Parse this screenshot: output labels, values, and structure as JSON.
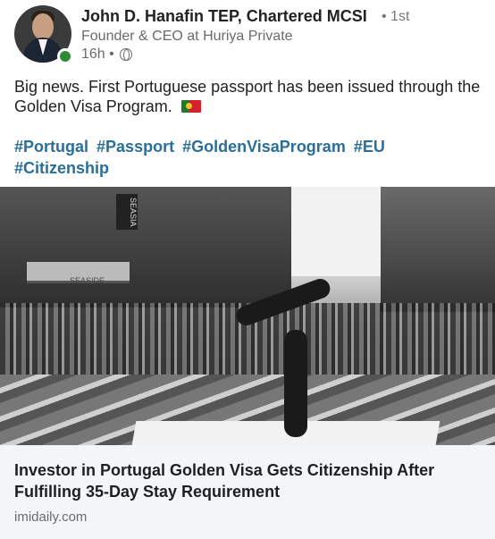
{
  "post": {
    "author": {
      "name": "John D. Hanafin TEP, Chartered MCSI",
      "connection_degree": "• 1st",
      "headline": "Founder & CEO at Huriya Private"
    },
    "time_ago": "16h •",
    "visibility_icon": "globe-icon",
    "text": "Big news. First Portuguese passport has been issued through the Golden Visa Program.",
    "flag_icon": "portugal-flag-icon",
    "hashtags": [
      "#Portugal",
      "#Passport",
      "#GoldenVisaProgram",
      "#EU",
      "#Citizenship"
    ]
  },
  "image": {
    "street_sign_text": "SEASIA",
    "shop_sign_text": "SEASIDE"
  },
  "link_preview": {
    "title": "Investor in Portugal Golden Visa Gets Citizenship After Fulfilling 35-Day Stay Requirement",
    "source": "imidaily.com"
  },
  "colors": {
    "hashtag": "#2a6f97",
    "online_status": "#2e8b33",
    "card_background": "#f3f6f8"
  }
}
